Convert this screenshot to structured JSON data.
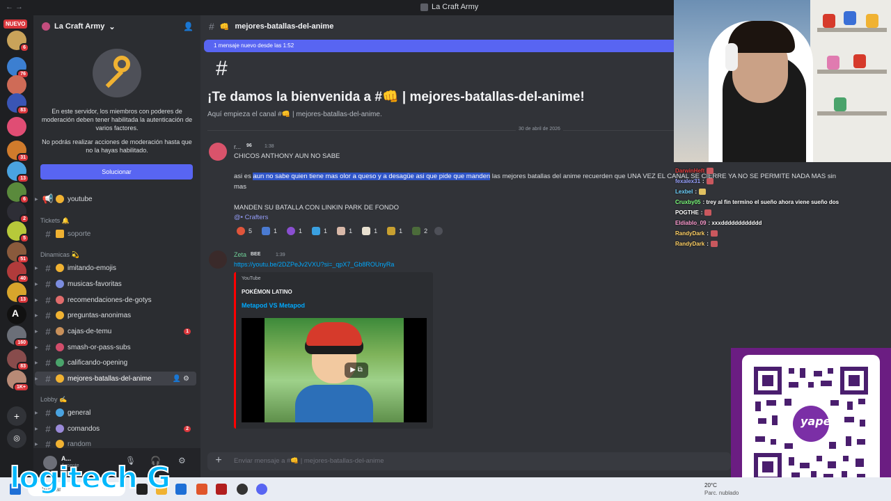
{
  "window": {
    "title": "La Craft Army"
  },
  "servers": {
    "new_label": "NUEVO",
    "badges": [
      "6",
      "76",
      "83",
      "31",
      "13",
      "6",
      "2",
      "5",
      "51",
      "40",
      "13",
      "160",
      "83",
      "1K+"
    ]
  },
  "guild": {
    "name": "La Craft Army"
  },
  "moderation_notice": {
    "line1": "En este servidor, los miembros con poderes de moderación deben tener habilitada la autenticación de varios factores.",
    "line2": "No podrás realizar acciones de moderación hasta que no la hayas habilitado.",
    "button": "Solucionar"
  },
  "channel_list": {
    "youtube": "youtube",
    "cat_tickets": "Tickets 🔔",
    "soporte": "soporte",
    "cat_dinamicas": "Dinamicas 💫",
    "items": [
      {
        "name": "imitando-emojis",
        "badge": ""
      },
      {
        "name": "musicas-favoritas",
        "badge": ""
      },
      {
        "name": "recomendaciones-de-gotys",
        "badge": ""
      },
      {
        "name": "preguntas-anonimas",
        "badge": ""
      },
      {
        "name": "cajas-de-temu",
        "badge": "1"
      },
      {
        "name": "smash-or-pass-subs",
        "badge": ""
      },
      {
        "name": "calificando-opening",
        "badge": ""
      },
      {
        "name": "mejores-batallas-del-anime",
        "badge": ""
      }
    ],
    "cat_lobby": "Lobby ✍️",
    "lobby": [
      {
        "name": "general",
        "badge": ""
      },
      {
        "name": "comandos",
        "badge": "2"
      },
      {
        "name": "random",
        "badge": ""
      }
    ]
  },
  "user": {
    "name": "A...",
    "status": "Ausente"
  },
  "chat": {
    "channel": "mejores-batallas-del-anime",
    "new_messages": "1 mensaje nuevo desde las 1:52",
    "welcome_title": "¡Te damos la bienvenida a #👊 | mejores-batallas-del-anime!",
    "welcome_sub": "Aquí empieza el canal #👊 | mejores-batallas-del-anime.",
    "date_divider": "30 de abril de 2026",
    "msg1": {
      "author": "r...",
      "tag": "96",
      "time": "1:38",
      "line1": "CHICOS ANTHONY AUN NO SABE",
      "line2_pre": "asi es ",
      "line2_sel": "aun no sabe quien tiene mas olor a queso y a desagüe asi que pide que manden",
      "line2_post": " las mejores batallas del anime recuerden que UNA VEZ EL CANAL SE CIERRE YA NO SE PERMITE NADA MAS sin",
      "line3": "mas",
      "line4": "MANDEN SU BATALLA CON LINKIN PARK DE FONDO",
      "mention": "@• Crafters",
      "reactions": [
        "5",
        "1",
        "1",
        "1",
        "1",
        "1",
        "1",
        "2"
      ]
    },
    "msg2": {
      "author": "Zeta",
      "tag": "BEE",
      "time": "1:39",
      "link": "https://youtu.be/2DZPeJv2VXU?si=_qpX7_Gb8ROUnyRa",
      "embed_provider": "YouTube",
      "embed_author": "POKÉMON LATINO",
      "embed_title": "Metapod VS Metapod"
    },
    "composer_placeholder": "Enviar mensaje a #👊 | mejores-batallas-del-anime"
  },
  "stream_chat": [
    {
      "user": "DarwinHeft",
      "text": "",
      "color": "#e33b3b"
    },
    {
      "user": "fexalex31",
      "text": "",
      "color": "#9aa3ff"
    },
    {
      "user": "Lexbel",
      "text": "",
      "color": "#6dd3ff"
    },
    {
      "user": "Cruxby05",
      "text": ": trey al fin termino el sueño ahora viene sueño dos",
      "color": "#7cff7c"
    },
    {
      "user": "POGTHE",
      "text": "",
      "color": "#ffffff"
    },
    {
      "user": "Eldiablo_09",
      "text": ": xxxdddddddddddd",
      "color": "#ff9bd0"
    },
    {
      "user": "RandyDark",
      "text": "",
      "color": "#ffd166"
    },
    {
      "user": "RandyDark",
      "text": "",
      "color": "#ffd166"
    }
  ],
  "taskbar": {
    "search": "Buscar",
    "temp": "20°C",
    "weather": "Parc. nublado"
  },
  "brand": {
    "logitech": "logitech G",
    "yape": "yape"
  },
  "colors": {
    "blurple": "#5865f2",
    "danger": "#da373c",
    "link": "#00a8fc",
    "yape_purple": "#6b1d82"
  }
}
